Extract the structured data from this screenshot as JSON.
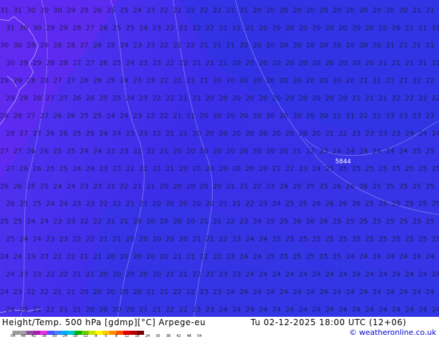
{
  "map": {
    "labels": {
      "top_left_row": "31 31 31 30 30",
      "highlight": "5844",
      "row_values": [
        [
          31,
          31,
          30,
          30,
          30,
          29,
          28,
          26,
          25,
          25,
          24,
          23,
          22,
          22,
          22,
          22,
          22,
          21,
          21,
          20,
          20,
          20,
          20,
          20,
          20,
          20,
          20,
          20,
          20,
          20,
          20,
          21,
          21
        ],
        [
          31,
          30,
          30,
          29,
          29,
          28,
          27,
          26,
          25,
          25,
          24,
          23,
          22,
          22,
          22,
          22,
          21,
          21,
          21,
          20,
          20,
          20,
          20,
          20,
          20,
          20,
          20,
          20,
          20,
          20,
          21,
          21,
          21
        ],
        [
          30,
          30,
          29,
          29,
          28,
          28,
          27,
          26,
          25,
          24,
          23,
          23,
          22,
          22,
          22,
          21,
          21,
          21,
          20,
          20,
          20,
          20,
          20,
          20,
          20,
          20,
          20,
          20,
          20,
          21,
          21,
          21,
          21
        ],
        [
          30,
          29,
          29,
          28,
          28,
          27,
          27,
          26,
          25,
          24,
          23,
          23,
          22,
          22,
          21,
          21,
          21,
          20,
          20,
          20,
          20,
          20,
          20,
          20,
          20,
          20,
          20,
          20,
          21,
          21,
          21,
          21,
          21
        ],
        [
          29,
          29,
          28,
          28,
          27,
          27,
          26,
          26,
          25,
          24,
          23,
          23,
          22,
          22,
          21,
          21,
          20,
          20,
          20,
          20,
          20,
          20,
          20,
          20,
          20,
          20,
          20,
          21,
          21,
          21,
          21,
          22,
          22
        ],
        [
          29,
          28,
          28,
          27,
          27,
          26,
          26,
          25,
          25,
          24,
          23,
          22,
          22,
          21,
          21,
          20,
          20,
          20,
          20,
          20,
          20,
          20,
          20,
          20,
          20,
          20,
          21,
          21,
          21,
          22,
          22,
          22,
          22
        ],
        [
          28,
          28,
          27,
          27,
          26,
          26,
          25,
          25,
          24,
          24,
          23,
          22,
          22,
          21,
          21,
          20,
          20,
          20,
          20,
          20,
          20,
          20,
          20,
          20,
          20,
          21,
          21,
          22,
          22,
          23,
          23,
          23,
          23
        ],
        [
          28,
          27,
          27,
          26,
          26,
          25,
          25,
          24,
          24,
          23,
          23,
          22,
          21,
          21,
          20,
          20,
          20,
          20,
          20,
          20,
          20,
          20,
          20,
          20,
          21,
          22,
          23,
          23,
          23,
          23,
          24,
          24,
          24
        ],
        [
          27,
          27,
          26,
          26,
          25,
          25,
          24,
          24,
          23,
          23,
          22,
          22,
          21,
          20,
          20,
          20,
          20,
          20,
          20,
          20,
          20,
          20,
          21,
          22,
          23,
          24,
          24,
          24,
          24,
          24,
          24,
          25,
          25
        ],
        [
          27,
          26,
          26,
          25,
          25,
          24,
          24,
          23,
          23,
          22,
          22,
          21,
          21,
          20,
          20,
          20,
          20,
          20,
          20,
          20,
          21,
          22,
          23,
          24,
          25,
          25,
          25,
          25,
          25,
          25,
          25,
          25,
          25
        ],
        [
          26,
          26,
          25,
          25,
          24,
          24,
          23,
          23,
          22,
          22,
          21,
          21,
          20,
          20,
          20,
          20,
          20,
          21,
          21,
          22,
          23,
          24,
          25,
          25,
          25,
          26,
          26,
          26,
          25,
          25,
          25,
          25,
          25
        ],
        [
          26,
          25,
          25,
          24,
          24,
          23,
          23,
          22,
          22,
          21,
          21,
          20,
          20,
          20,
          20,
          20,
          21,
          21,
          22,
          23,
          24,
          25,
          25,
          26,
          26,
          26,
          26,
          25,
          25,
          25,
          25,
          25,
          25
        ],
        [
          25,
          25,
          24,
          24,
          23,
          23,
          22,
          22,
          21,
          21,
          20,
          20,
          20,
          20,
          20,
          21,
          21,
          22,
          23,
          24,
          25,
          25,
          26,
          26,
          26,
          25,
          25,
          25,
          25,
          25,
          25,
          25,
          25
        ],
        [
          25,
          24,
          24,
          23,
          23,
          22,
          22,
          21,
          21,
          20,
          20,
          20,
          20,
          20,
          21,
          21,
          22,
          23,
          24,
          24,
          25,
          25,
          25,
          25,
          25,
          25,
          25,
          25,
          25,
          25,
          25,
          25,
          25
        ],
        [
          24,
          24,
          23,
          23,
          22,
          22,
          21,
          21,
          20,
          20,
          20,
          20,
          20,
          21,
          21,
          22,
          22,
          23,
          24,
          24,
          25,
          25,
          25,
          25,
          25,
          25,
          24,
          24,
          24,
          24,
          24,
          24,
          24
        ],
        [
          24,
          23,
          23,
          22,
          22,
          21,
          21,
          20,
          20,
          20,
          20,
          20,
          21,
          21,
          22,
          22,
          23,
          23,
          24,
          24,
          24,
          24,
          24,
          24,
          24,
          24,
          24,
          24,
          24,
          24,
          24,
          24,
          24
        ],
        [
          24,
          23,
          22,
          22,
          21,
          21,
          20,
          20,
          20,
          20,
          20,
          21,
          21,
          22,
          22,
          23,
          23,
          24,
          24,
          24,
          24,
          24,
          24,
          24,
          24,
          24,
          24,
          24,
          24,
          24,
          24,
          24,
          24
        ],
        [
          24,
          23,
          22,
          22,
          21,
          21,
          20,
          20,
          20,
          20,
          21,
          21,
          22,
          22,
          23,
          23,
          24,
          24,
          24,
          24,
          24,
          24,
          24,
          24,
          24,
          24,
          24,
          24,
          24,
          24,
          24,
          24,
          24
        ]
      ]
    }
  },
  "footer": {
    "title": "Height/Temp. 500 hPa [gdmp][°C] Arpege-eu",
    "valid": "Tu 02-12-2025 18:00 UTC (12+06)",
    "credit": "© weatheronline.co.uk",
    "legend_ticks": [
      "-54",
      "-48",
      "-42",
      "-38",
      "-30",
      "-24",
      "-18",
      "-12",
      "-8",
      "0",
      "8",
      "12",
      "18",
      "24",
      "30",
      "38",
      "42",
      "48",
      "54"
    ],
    "legend_colors": [
      "#9b9b9b",
      "#a0a0a0",
      "#8d4e9d",
      "#b01ab0",
      "#e030e0",
      "#5050ff",
      "#3c82ff",
      "#00aaff",
      "#00c8c8",
      "#00b400",
      "#6ecc00",
      "#c8e600",
      "#ffff00",
      "#ffc800",
      "#ff8c00",
      "#ff5000",
      "#e60000",
      "#b40000",
      "#780000"
    ]
  }
}
